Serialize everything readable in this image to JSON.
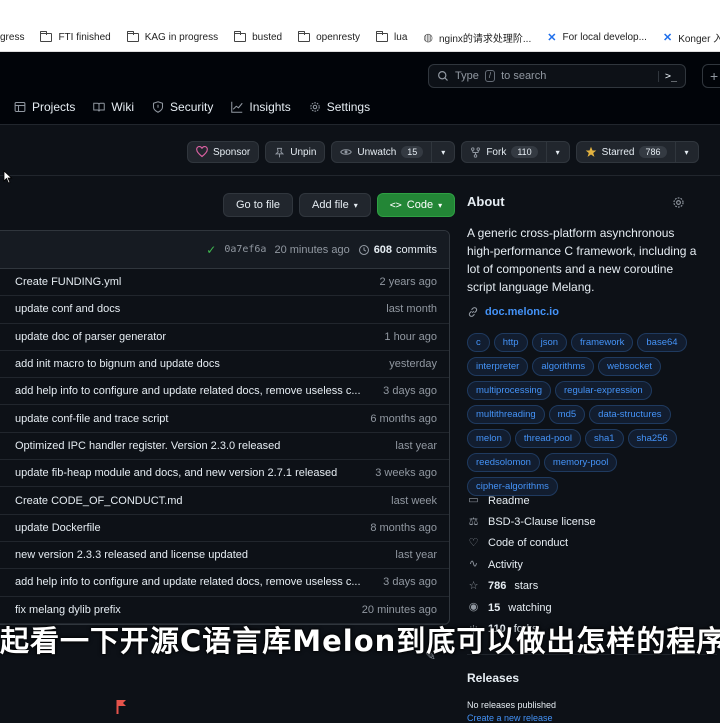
{
  "bookmarks": [
    {
      "label": "gress",
      "icon": "folder-icon"
    },
    {
      "label": "FTI finished",
      "icon": "folder-icon"
    },
    {
      "label": "KAG in progress",
      "icon": "folder-icon"
    },
    {
      "label": "busted",
      "icon": "folder-icon"
    },
    {
      "label": "openresty",
      "icon": "folder-icon"
    },
    {
      "label": "lua",
      "icon": "folder-icon"
    },
    {
      "label": "nginx的请求处理阶...",
      "icon": "globe-icon"
    },
    {
      "label": "For local develop...",
      "icon": "confluence-icon"
    },
    {
      "label": "Konger 入门指南 -...",
      "icon": "confluence-icon"
    }
  ],
  "search": {
    "placeholder_before": "Type",
    "key": "/",
    "placeholder_after": "to search",
    "command_glyph": ">_"
  },
  "nav": [
    {
      "label": "Projects",
      "icon": "table-icon"
    },
    {
      "label": "Wiki",
      "icon": "book-icon"
    },
    {
      "label": "Security",
      "icon": "shield-icon"
    },
    {
      "label": "Insights",
      "icon": "graph-icon"
    },
    {
      "label": "Settings",
      "icon": "gear-icon"
    }
  ],
  "actions": {
    "sponsor": "Sponsor",
    "unpin": "Unpin",
    "unwatch": "Unwatch",
    "watch_count": "15",
    "fork": "Fork",
    "fork_count": "110",
    "starred": "Starred",
    "star_count": "786"
  },
  "file_buttons": {
    "goto": "Go to file",
    "add": "Add file",
    "code": "Code"
  },
  "commit_bar": {
    "hash": "0a7ef6a",
    "time": "20 minutes ago",
    "count": "608",
    "commits_label": "commits"
  },
  "files": [
    {
      "message": "Create FUNDING.yml",
      "time": "2 years ago"
    },
    {
      "message": "update conf and docs",
      "time": "last month"
    },
    {
      "message": "update doc of parser generator",
      "time": "1 hour ago"
    },
    {
      "message": "add init macro to bignum and update docs",
      "time": "yesterday"
    },
    {
      "message": "add help info to configure and update related docs, remove useless c...",
      "time": "3 days ago"
    },
    {
      "message": "update conf-file and trace script",
      "time": "6 months ago"
    },
    {
      "message": "Optimized IPC handler register. Version 2.3.0 released",
      "time": "last year"
    },
    {
      "message": "update fib-heap module and docs, and new version 2.7.1 released",
      "time": "3 weeks ago"
    },
    {
      "message": "Create CODE_OF_CONDUCT.md",
      "time": "last week"
    },
    {
      "message": "update Dockerfile",
      "time": "8 months ago"
    },
    {
      "message": "new version 2.3.3 released and license updated",
      "time": "last year"
    },
    {
      "message": "add help info to configure and update related docs, remove useless c...",
      "time": "3 days ago"
    },
    {
      "message": "fix melang dylib prefix",
      "time": "20 minutes ago"
    }
  ],
  "about": {
    "title": "About",
    "description": "A generic cross-platform asynchronous high-performance C framework, including a lot of components and a new coroutine script language Melang.",
    "link": "doc.melonc.io",
    "topics": [
      "c",
      "http",
      "json",
      "framework",
      "base64",
      "interpreter",
      "algorithms",
      "websocket",
      "multiprocessing",
      "regular-expression",
      "multithreading",
      "md5",
      "data-structures",
      "melon",
      "thread-pool",
      "sha1",
      "sha256",
      "reedsolomon",
      "memory-pool",
      "cipher-algorithms"
    ],
    "meta": [
      {
        "icon": "book-icon",
        "text": "Readme",
        "bold": ""
      },
      {
        "icon": "law-icon",
        "text": "BSD-3-Clause license",
        "bold": ""
      },
      {
        "icon": "heart-code-icon",
        "text": "Code of conduct",
        "bold": ""
      },
      {
        "icon": "pulse-icon",
        "text": "Activity",
        "bold": ""
      },
      {
        "icon": "star-icon",
        "text": "stars",
        "bold": "786"
      },
      {
        "icon": "eye-icon",
        "text": "watching",
        "bold": "15"
      },
      {
        "icon": "fork-icon",
        "text": "forks",
        "bold": "110"
      }
    ]
  },
  "releases": {
    "title": "Releases",
    "none": "No releases published",
    "create": "Create a new release"
  },
  "subtitle": "起看一下开源C语言库Melon到底可以做出怎样的程序"
}
